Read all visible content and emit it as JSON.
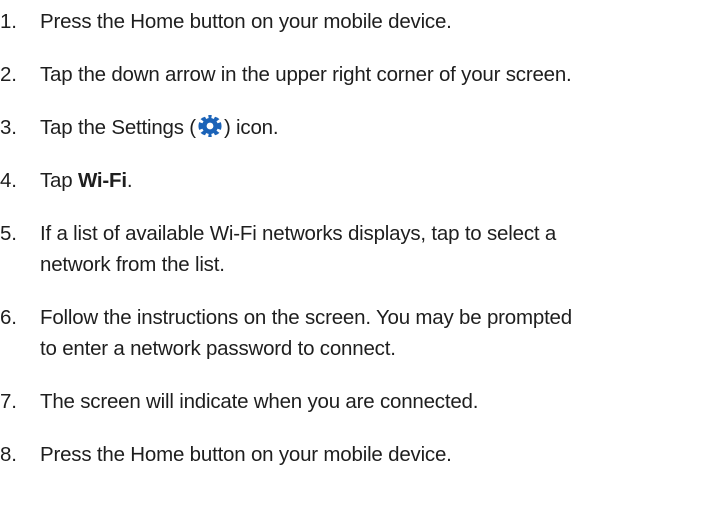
{
  "steps": [
    {
      "number": "1.",
      "lines": [
        "Press the Home button on your mobile device."
      ]
    },
    {
      "number": "2.",
      "lines": [
        "Tap the down arrow in the upper right corner of your screen."
      ]
    },
    {
      "number": "3.",
      "before": "Tap the Settings (",
      "icon": "gear-icon",
      "after": ") icon."
    },
    {
      "number": "4.",
      "before": "Tap ",
      "bold": "Wi-Fi",
      "after": "."
    },
    {
      "number": "5.",
      "lines": [
        "If a list of available Wi-Fi networks displays, tap to select a",
        "network from the list."
      ]
    },
    {
      "number": "6.",
      "lines": [
        "Follow the instructions on the screen. You may be prompted",
        "to enter a network password to connect."
      ]
    },
    {
      "number": "7.",
      "lines": [
        "The screen will indicate when you are connected."
      ]
    },
    {
      "number": "8.",
      "lines": [
        "Press the Home button on your mobile device."
      ]
    }
  ],
  "colors": {
    "text": "#1e1e1e",
    "icon": "#1b63b8"
  }
}
